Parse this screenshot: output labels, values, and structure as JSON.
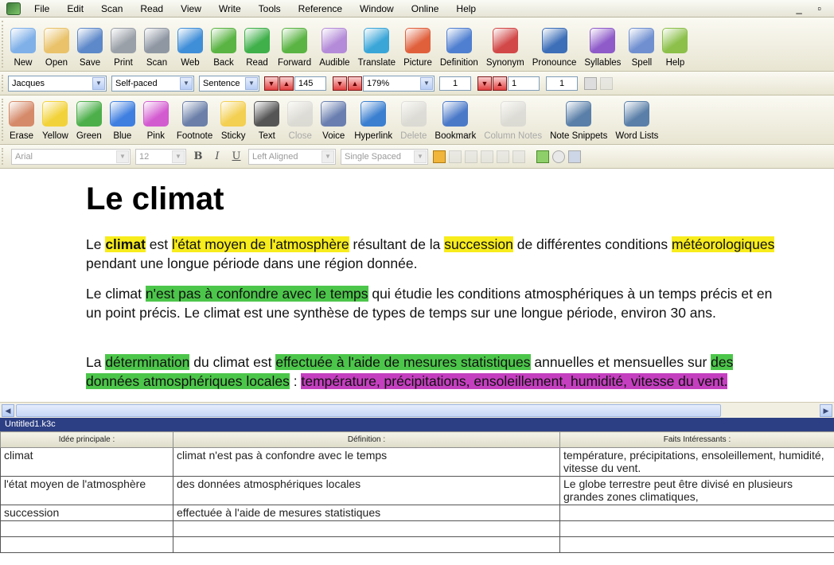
{
  "menu": [
    "File",
    "Edit",
    "Scan",
    "Read",
    "View",
    "Write",
    "Tools",
    "Reference",
    "Window",
    "Online",
    "Help"
  ],
  "window_controls": "_ ▫",
  "toolbar_main": [
    {
      "label": "New",
      "icon": "new-document-icon",
      "color": "#7fb0e8"
    },
    {
      "label": "Open",
      "icon": "open-folder-icon",
      "color": "#e9c26a"
    },
    {
      "label": "Save",
      "icon": "save-disk-icon",
      "color": "#5d88c9"
    },
    {
      "label": "Print",
      "icon": "printer-icon",
      "color": "#9aa0a8"
    },
    {
      "label": "Scan",
      "icon": "scanner-icon",
      "color": "#8f97a3"
    },
    {
      "label": "Web",
      "icon": "globe-icon",
      "color": "#3f8ed8"
    },
    {
      "label": "Back",
      "icon": "back-arrow-icon",
      "color": "#5ab443"
    },
    {
      "label": "Read",
      "icon": "play-icon",
      "color": "#3fb04a"
    },
    {
      "label": "Forward",
      "icon": "forward-arrow-icon",
      "color": "#5ab443"
    },
    {
      "label": "Audible",
      "icon": "speaker-icon",
      "color": "#b48bd8"
    },
    {
      "label": "Translate",
      "icon": "translate-icon",
      "color": "#3aa6d8"
    },
    {
      "label": "Picture",
      "icon": "picture-icon",
      "color": "#e0603c"
    },
    {
      "label": "Definition",
      "icon": "definition-book-icon",
      "color": "#4f7fd0"
    },
    {
      "label": "Synonym",
      "icon": "synonym-book-icon",
      "color": "#d24848"
    },
    {
      "label": "Pronounce",
      "icon": "pronounce-icon",
      "color": "#3d6fb8"
    },
    {
      "label": "Syllables",
      "icon": "syllables-icon",
      "color": "#8e5bc9"
    },
    {
      "label": "Spell",
      "icon": "spell-abc-icon",
      "color": "#6f8fd0"
    },
    {
      "label": "Help",
      "icon": "help-question-icon",
      "color": "#8cc04a"
    }
  ],
  "toolbar_reading": {
    "voice": "Jacques",
    "mode": "Self-paced",
    "unit": "Sentence",
    "speed": "145",
    "zoom": "179%",
    "page_a": "1",
    "page_b": "1",
    "page_c": "1"
  },
  "toolbar_study": [
    {
      "label": "Erase",
      "icon": "eraser-icon",
      "color": "#d58a6a",
      "disabled": false
    },
    {
      "label": "Yellow",
      "icon": "yellow-highlighter-icon",
      "color": "#f2d23a",
      "disabled": false
    },
    {
      "label": "Green",
      "icon": "green-highlighter-icon",
      "color": "#4caf4a",
      "disabled": false
    },
    {
      "label": "Blue",
      "icon": "blue-highlighter-icon",
      "color": "#3f7fe0",
      "disabled": false
    },
    {
      "label": "Pink",
      "icon": "pink-highlighter-icon",
      "color": "#d35bd0",
      "disabled": false
    },
    {
      "label": "Footnote",
      "icon": "footnote-icon",
      "color": "#6b7fa8",
      "disabled": false
    },
    {
      "label": "Sticky",
      "icon": "sticky-note-icon",
      "color": "#f3cf52",
      "disabled": false
    },
    {
      "label": "Text",
      "icon": "text-a-icon",
      "color": "#555555",
      "disabled": false
    },
    {
      "label": "Close",
      "icon": "close-note-icon",
      "color": "#c8c8c8",
      "disabled": true
    },
    {
      "label": "Voice",
      "icon": "microphone-icon",
      "color": "#6a7fb0",
      "disabled": false
    },
    {
      "label": "Hyperlink",
      "icon": "hyperlink-icon",
      "color": "#3a7fd0",
      "disabled": false
    },
    {
      "label": "Delete",
      "icon": "delete-icon",
      "color": "#c8c8c8",
      "disabled": true
    },
    {
      "label": "Bookmark",
      "icon": "bookmark-icon",
      "color": "#4a79c8",
      "disabled": false
    },
    {
      "label": "Column Notes",
      "icon": "column-notes-icon",
      "color": "#c8c8c8",
      "disabled": true
    },
    {
      "label": "Note Snippets",
      "icon": "note-snippets-icon",
      "color": "#5a7fa8",
      "disabled": false
    },
    {
      "label": "Word Lists",
      "icon": "word-lists-icon",
      "color": "#5a7fa8",
      "disabled": false
    }
  ],
  "toolbar_format": {
    "font": "Arial",
    "size": "12",
    "bold": "B",
    "italic": "I",
    "underline": "U",
    "align": "Left Aligned",
    "spacing": "Single Spaced"
  },
  "document": {
    "title": "Le climat",
    "p1": [
      {
        "t": "Le ",
        "h": ""
      },
      {
        "t": "climat",
        "h": "y",
        "b": true
      },
      {
        "t": " est ",
        "h": ""
      },
      {
        "t": "l'état moyen de l'atmosphère",
        "h": "y"
      },
      {
        "t": " résultant de la ",
        "h": ""
      },
      {
        "t": "succession",
        "h": "y"
      },
      {
        "t": " de différentes conditions ",
        "h": ""
      },
      {
        "t": "météorologiques",
        "h": "y"
      },
      {
        "t": " pendant une longue période dans une région donnée.",
        "h": ""
      }
    ],
    "p2": [
      {
        "t": "Le climat ",
        "h": ""
      },
      {
        "t": "n'est pas à confondre avec le temps",
        "h": "g"
      },
      {
        "t": " qui étudie les conditions atmosphériques à un temps précis et en un point précis. Le climat est une synthèse de types de temps sur une longue période, environ 30 ans.",
        "h": ""
      }
    ],
    "p3": [
      {
        "t": "La ",
        "h": ""
      },
      {
        "t": "détermination",
        "h": "g"
      },
      {
        "t": " du climat est ",
        "h": ""
      },
      {
        "t": "effectuée à l'aide de mesures statistiques",
        "h": "g"
      },
      {
        "t": " annuelles et mensuelles sur ",
        "h": ""
      },
      {
        "t": "des données atmosphériques locales",
        "h": "g"
      },
      {
        "t": " : ",
        "h": ""
      },
      {
        "t": "température, précipitations, ensoleillement, humidité, vitesse du vent.",
        "h": "p"
      }
    ]
  },
  "notes_panel": {
    "title": "Untitled1.k3c",
    "headers": [
      "Idée principale :",
      "Définition :",
      "Faits Intéressants :"
    ],
    "rows": [
      [
        "climat",
        "climat n'est pas à confondre avec le temps",
        "température, précipitations, ensoleillement, humidité, vitesse du vent."
      ],
      [
        "l'état moyen de l'atmosphère",
        "des données atmosphériques locales",
        "Le globe terrestre peut être divisé en plusieurs grandes zones climatiques,"
      ],
      [
        "succession",
        "effectuée à l'aide de mesures statistiques",
        ""
      ],
      [
        "",
        "",
        ""
      ],
      [
        "",
        "",
        ""
      ]
    ]
  },
  "colors": {
    "highlight_yellow": "#f7ec1c",
    "highlight_green": "#4cc64a",
    "highlight_pink": "#c43fbf",
    "panel_title_bg": "#2c3f84"
  }
}
